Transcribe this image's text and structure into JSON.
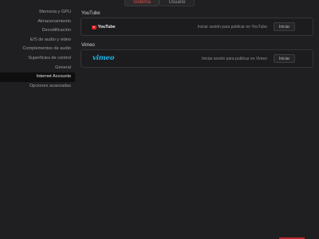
{
  "tabs": [
    {
      "label": "Sistema",
      "active": true
    },
    {
      "label": "Usuario",
      "active": false
    }
  ],
  "sidebar": {
    "items": [
      {
        "label": "Memoria y GPU"
      },
      {
        "label": "Almacenamiento"
      },
      {
        "label": "Decodificación"
      },
      {
        "label": "E/S de audio y video"
      },
      {
        "label": "Complementos de audio"
      },
      {
        "label": "Superficies de control"
      },
      {
        "label": "General"
      },
      {
        "label": "Internet Accounts"
      },
      {
        "label": "Opciones avanzadas"
      }
    ],
    "active_index": 7
  },
  "accounts": {
    "youtube": {
      "section_title": "YouTube",
      "logo_text": "YouTube",
      "signin_text": "Iniciar sesión para publicar en YouTube",
      "button_label": "Iniciar"
    },
    "vimeo": {
      "section_title": "Vimeo",
      "logo_text": "vimeo",
      "signin_text": "Iniciar sesión para publicar en Vimeo",
      "button_label": "Iniciar"
    }
  },
  "colors": {
    "accent": "#e84a4a",
    "youtube_red": "#e02020",
    "vimeo_blue": "#1ab7ea",
    "background": "#1f1f21"
  }
}
